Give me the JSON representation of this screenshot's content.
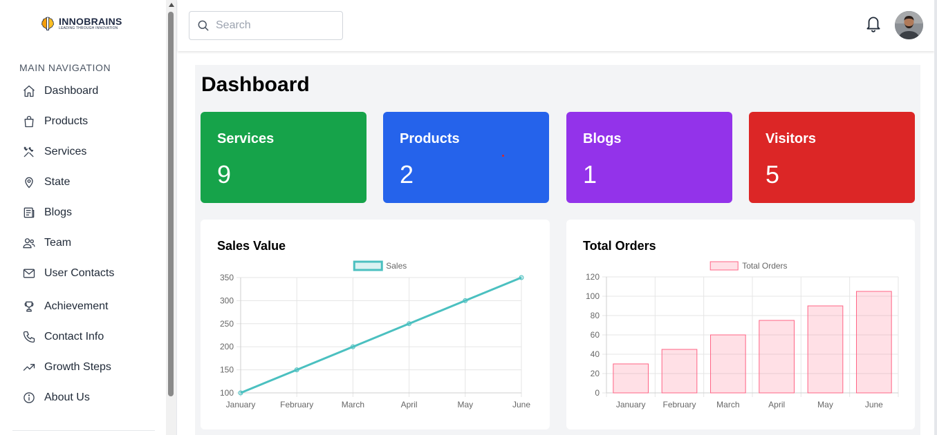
{
  "brand": {
    "name": "INNOBRAINS",
    "tagline": "LEADING THROUGH INNOVATION"
  },
  "sidebar": {
    "heading": "MAIN NAVIGATION",
    "items": [
      {
        "label": "Dashboard",
        "icon": "home-icon"
      },
      {
        "label": "Products",
        "icon": "shopping-bag-icon"
      },
      {
        "label": "Services",
        "icon": "tools-icon"
      },
      {
        "label": "State",
        "icon": "map-pin-icon"
      },
      {
        "label": "Blogs",
        "icon": "newspaper-icon"
      },
      {
        "label": "Team",
        "icon": "users-icon"
      },
      {
        "label": "User Contacts",
        "icon": "mail-icon"
      },
      {
        "label": "Achievement",
        "icon": "trophy-icon"
      },
      {
        "label": "Contact Info",
        "icon": "phone-icon"
      },
      {
        "label": "Growth Steps",
        "icon": "trending-up-icon"
      },
      {
        "label": "About Us",
        "icon": "info-icon"
      }
    ]
  },
  "topbar": {
    "search_placeholder": "Search",
    "search_value": ""
  },
  "main": {
    "title": "Dashboard",
    "cards": [
      {
        "title": "Services",
        "value": "9",
        "color": "#16a34a"
      },
      {
        "title": "Products",
        "value": "2",
        "color": "#2563eb"
      },
      {
        "title": "Blogs",
        "value": "1",
        "color": "#9333ea"
      },
      {
        "title": "Visitors",
        "value": "5",
        "color": "#dc2626"
      }
    ],
    "sales_panel_title": "Sales Value",
    "orders_panel_title": "Total Orders"
  },
  "chart_data": [
    {
      "type": "line",
      "categories": [
        "January",
        "February",
        "March",
        "April",
        "May",
        "June"
      ],
      "series": [
        {
          "name": "Sales",
          "values": [
            100,
            150,
            200,
            250,
            300,
            350
          ],
          "color": "#4bc0c0"
        }
      ],
      "yticks": [
        100,
        150,
        200,
        250,
        300,
        350
      ],
      "ylim": [
        100,
        350
      ],
      "grid": true,
      "legend": "top-center"
    },
    {
      "type": "bar",
      "categories": [
        "January",
        "February",
        "March",
        "April",
        "May",
        "June"
      ],
      "series": [
        {
          "name": "Total Orders",
          "values": [
            30,
            45,
            60,
            75,
            90,
            105
          ],
          "color": "#ff6384"
        }
      ],
      "yticks": [
        0,
        20,
        40,
        60,
        80,
        100,
        120
      ],
      "ylim": [
        0,
        120
      ],
      "grid": true,
      "legend": "top-center"
    }
  ]
}
